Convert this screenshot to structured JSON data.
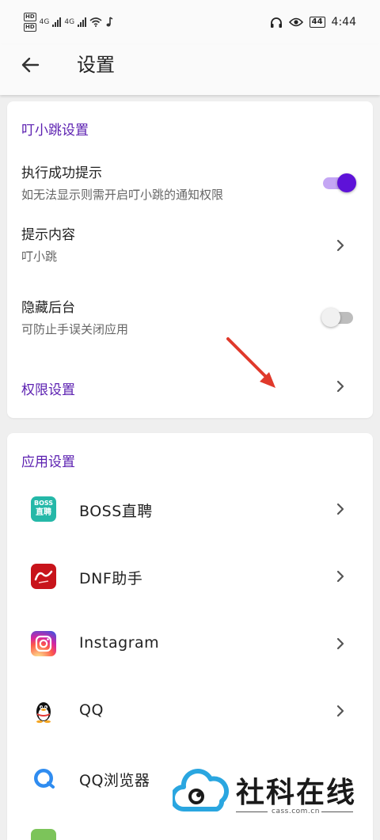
{
  "status_bar": {
    "hd1": "HD",
    "hd2": "HD",
    "net1": "4G",
    "net2": "4G",
    "battery": "44",
    "time": "4:44"
  },
  "app_bar": {
    "title": "设置"
  },
  "section1": {
    "title": "叮小跳设置",
    "rows": [
      {
        "title": "执行成功提示",
        "subtitle": "如无法显示则需开启叮小跳的通知权限",
        "control": "switch",
        "checked": true
      },
      {
        "title": "提示内容",
        "subtitle": "叮小跳",
        "control": "chevron"
      },
      {
        "title": "隐藏后台",
        "subtitle": "可防止手误关闭应用",
        "control": "switch",
        "checked": false
      },
      {
        "title": "权限设置",
        "control": "chevron"
      }
    ]
  },
  "section2": {
    "title": "应用设置",
    "apps": [
      {
        "name": "BOSS直聘",
        "icon": "boss-icon",
        "icon_text_top": "BOSS",
        "icon_text_bottom": "直聘"
      },
      {
        "name": "DNF助手",
        "icon": "dnf-icon"
      },
      {
        "name": "Instagram",
        "icon": "instagram-icon"
      },
      {
        "name": "QQ",
        "icon": "qq-penguin-icon"
      },
      {
        "name": "QQ浏览器",
        "icon": "qq-browser-icon"
      }
    ]
  },
  "watermark": {
    "text": "社科在线",
    "url": "cass.com.cn"
  },
  "colors": {
    "accent": "#5e12d8",
    "section_title": "#5b1fb0",
    "annotation_arrow": "#e0392b"
  }
}
